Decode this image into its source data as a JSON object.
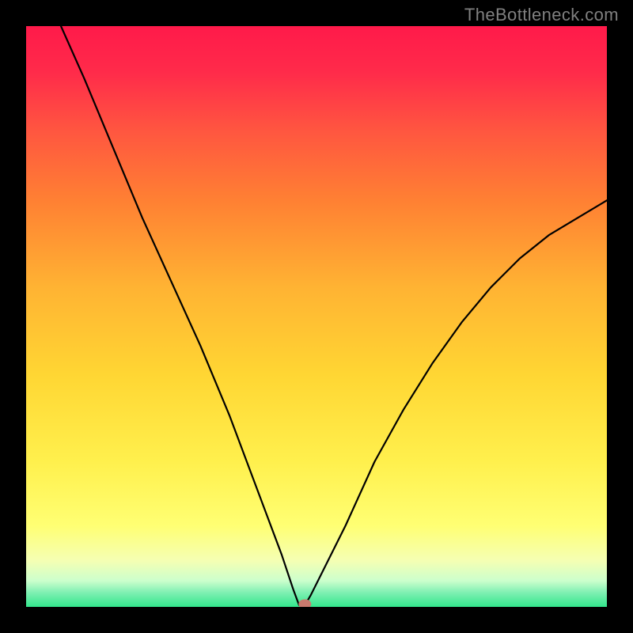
{
  "watermark": "TheBottleneck.com",
  "chart_data": {
    "type": "line",
    "title": "",
    "xlabel": "",
    "ylabel": "",
    "xlim": [
      0,
      100
    ],
    "ylim": [
      0,
      100
    ],
    "gradient": {
      "top_color": "#ff1a4a",
      "mid_upper_color": "#ff8c33",
      "mid_color": "#ffd633",
      "mid_lower_color": "#ffff66",
      "bottom_color": "#33e68c"
    },
    "curve": {
      "minimum_x": 47,
      "minimum_y": 0,
      "left_end_x": 6,
      "left_end_y": 100,
      "right_end_x": 100,
      "right_end_y": 70,
      "points": [
        {
          "x": 6,
          "y": 100
        },
        {
          "x": 10,
          "y": 91
        },
        {
          "x": 15,
          "y": 79
        },
        {
          "x": 20,
          "y": 67
        },
        {
          "x": 25,
          "y": 56
        },
        {
          "x": 30,
          "y": 45
        },
        {
          "x": 35,
          "y": 33
        },
        {
          "x": 38,
          "y": 25
        },
        {
          "x": 41,
          "y": 17
        },
        {
          "x": 44,
          "y": 9
        },
        {
          "x": 46,
          "y": 3
        },
        {
          "x": 47,
          "y": 0.3
        },
        {
          "x": 48,
          "y": 0.3
        },
        {
          "x": 49,
          "y": 2
        },
        {
          "x": 51,
          "y": 6
        },
        {
          "x": 55,
          "y": 14
        },
        {
          "x": 60,
          "y": 25
        },
        {
          "x": 65,
          "y": 34
        },
        {
          "x": 70,
          "y": 42
        },
        {
          "x": 75,
          "y": 49
        },
        {
          "x": 80,
          "y": 55
        },
        {
          "x": 85,
          "y": 60
        },
        {
          "x": 90,
          "y": 64
        },
        {
          "x": 95,
          "y": 67
        },
        {
          "x": 100,
          "y": 70
        }
      ]
    },
    "marker": {
      "x": 48,
      "y": 0.5,
      "color": "#c97a6e"
    }
  }
}
